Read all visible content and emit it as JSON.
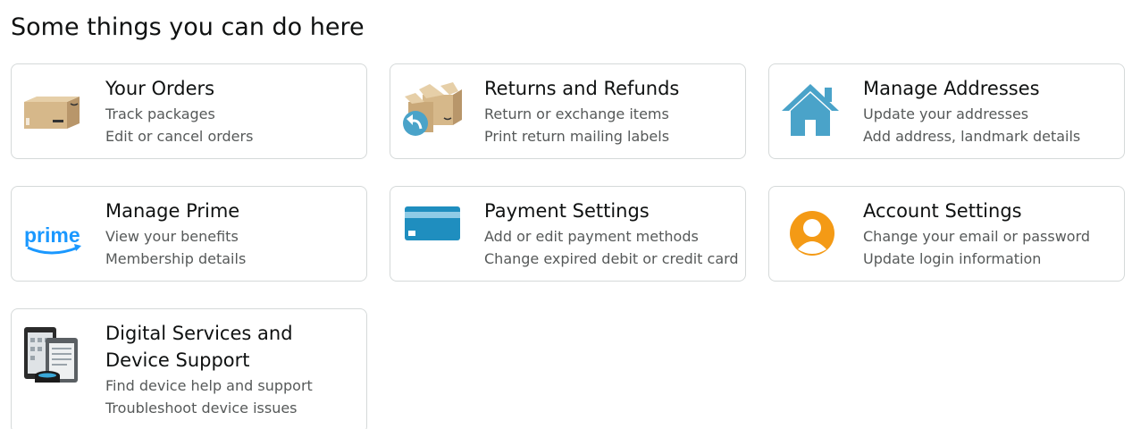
{
  "page": {
    "title": "Some things you can do here"
  },
  "colors": {
    "title_text": "#0f1111",
    "secondary_text": "#565959",
    "card_border": "#d5d9d9",
    "box_brown": "#d6b88a",
    "prime_blue": "#1a98ff",
    "home_blue": "#4aa3c9",
    "card_blue": "#1f8ebf",
    "account_orange": "#f49a15"
  },
  "cards": [
    {
      "title": "Your Orders",
      "lines": [
        "Track packages",
        "Edit or cancel orders"
      ],
      "icon": "package-box-icon"
    },
    {
      "title": "Returns and Refunds",
      "lines": [
        "Return or exchange items",
        "Print return mailing labels"
      ],
      "icon": "return-boxes-icon"
    },
    {
      "title": "Manage Addresses",
      "lines": [
        "Update your addresses",
        "Add address, landmark details"
      ],
      "icon": "house-icon"
    },
    {
      "title": "Manage Prime",
      "lines": [
        "View your benefits",
        "Membership details"
      ],
      "icon": "prime-logo-icon",
      "icon_text": "prime"
    },
    {
      "title": "Payment Settings",
      "lines": [
        "Add or edit payment methods",
        "Change expired debit or credit card"
      ],
      "icon": "credit-card-icon"
    },
    {
      "title": "Account Settings",
      "lines": [
        "Change your email or password",
        "Update login information"
      ],
      "icon": "user-avatar-icon"
    },
    {
      "title": "Digital Services and Device Support",
      "lines": [
        "Find device help and support",
        "Troubleshoot device issues"
      ],
      "icon": "devices-icon"
    }
  ]
}
